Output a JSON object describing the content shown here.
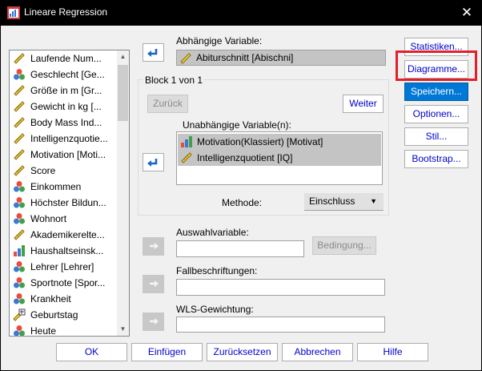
{
  "window": {
    "title": "Lineare Regression",
    "close_glyph": "✕"
  },
  "variables": [
    {
      "label": "Laufende Num...",
      "icon": "ruler-icon"
    },
    {
      "label": "Geschlecht [Ge...",
      "icon": "nominal-icon"
    },
    {
      "label": "Größe in m [Gr...",
      "icon": "ruler-icon"
    },
    {
      "label": "Gewicht in kg [...",
      "icon": "ruler-icon"
    },
    {
      "label": "Body Mass Ind...",
      "icon": "ruler-icon"
    },
    {
      "label": "Intelligenzquotie...",
      "icon": "ruler-icon"
    },
    {
      "label": "Motivation [Moti...",
      "icon": "ruler-icon"
    },
    {
      "label": "Score",
      "icon": "ruler-icon"
    },
    {
      "label": "Einkommen",
      "icon": "nominal-icon"
    },
    {
      "label": "Höchster Bildun...",
      "icon": "nominal-icon"
    },
    {
      "label": "Wohnort",
      "icon": "nominal-icon"
    },
    {
      "label": "Akademikerelte...",
      "icon": "ruler-icon"
    },
    {
      "label": "Haushaltseinsk...",
      "icon": "ordinal-icon"
    },
    {
      "label": "Lehrer [Lehrer]",
      "icon": "nominal-icon"
    },
    {
      "label": "Sportnote [Spor...",
      "icon": "nominal-icon"
    },
    {
      "label": "Krankheit",
      "icon": "nominal-icon"
    },
    {
      "label": "Geburtstag",
      "icon": "date-icon"
    },
    {
      "label": "Heute",
      "icon": "nominal-icon"
    }
  ],
  "dependent": {
    "label": "Abhängige Variable:",
    "value": "Abiturschnitt [Abischni]"
  },
  "block": {
    "label": "Block 1 von 1",
    "back_button": "Zurück",
    "next_button": "Weiter"
  },
  "independent": {
    "label": "Unabhängige Variable(n):",
    "items": [
      {
        "label": "Motivation(Klassiert) [Motivat]",
        "icon": "ordinal-icon"
      },
      {
        "label": "Intelligenzquotient [IQ]",
        "icon": "ruler-icon"
      }
    ]
  },
  "method": {
    "label": "Methode:",
    "value": "Einschluss"
  },
  "selection_variable": {
    "label": "Auswahlvariable:",
    "button": "Bedingung..."
  },
  "case_labels": {
    "label": "Fallbeschriftungen:"
  },
  "wls_weight": {
    "label": "WLS-Gewichtung:"
  },
  "side_buttons": {
    "statistics": "Statistiken...",
    "plots": "Diagramme...",
    "save": "Speichern...",
    "options": "Optionen...",
    "style": "Stil...",
    "bootstrap": "Bootstrap..."
  },
  "bottom_buttons": {
    "ok": "OK",
    "paste": "Einfügen",
    "reset": "Zurücksetzen",
    "cancel": "Abbrechen",
    "help": "Hilfe"
  },
  "colors": {
    "accent": "#0078d7",
    "highlight": "#e0202a",
    "link_text": "#0000d0"
  }
}
